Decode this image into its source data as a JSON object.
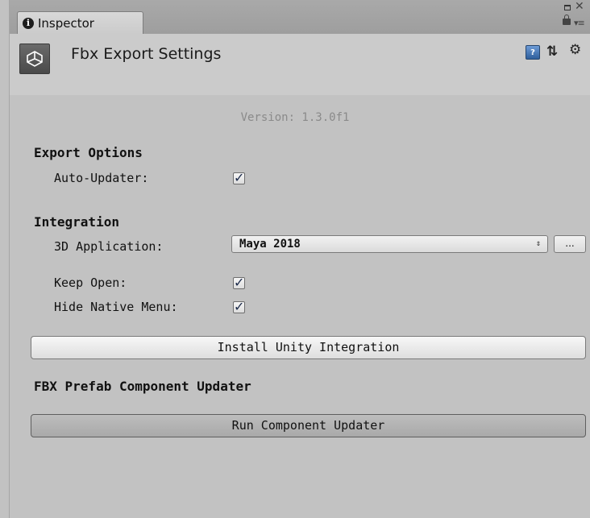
{
  "tab": {
    "label": "Inspector",
    "info_glyph": "i"
  },
  "header": {
    "title": "Fbx Export Settings",
    "help_glyph": "?"
  },
  "version": "Version: 1.3.0f1",
  "export_options": {
    "title": "Export Options",
    "auto_updater": {
      "label": "Auto-Updater:",
      "checked": true
    }
  },
  "integration": {
    "title": "Integration",
    "application": {
      "label": "3D Application:",
      "selected": "Maya 2018"
    },
    "ellipsis_label": "...",
    "keep_open": {
      "label": "Keep Open:",
      "checked": true
    },
    "hide_native_menu": {
      "label": "Hide Native Menu:",
      "checked": true
    },
    "install_button": "Install Unity Integration"
  },
  "prefab_updater": {
    "title": "FBX Prefab Component Updater",
    "run_button": "Run Component Updater"
  },
  "colors": {
    "background": "#c2c2c2",
    "header": "#cbcbcb",
    "version_text": "#8a8a8a"
  }
}
